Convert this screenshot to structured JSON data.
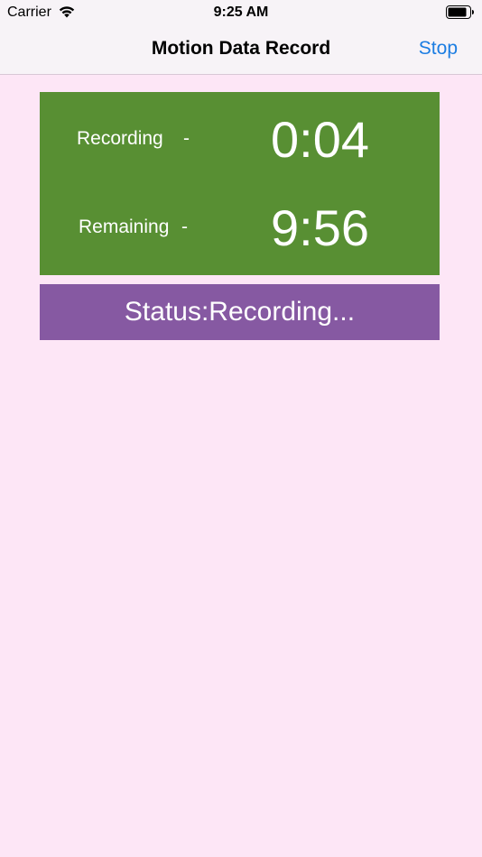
{
  "status_bar": {
    "carrier": "Carrier",
    "time": "9:25 AM"
  },
  "nav": {
    "title": "Motion Data Record",
    "action": "Stop"
  },
  "timers": {
    "recording_label": "Recording",
    "recording_dash": "-",
    "recording_value": "0:04",
    "remaining_label": "Remaining",
    "remaining_dash": "-",
    "remaining_value": "9:56"
  },
  "status": {
    "text": "Status:Recording..."
  },
  "icons": {
    "wifi": "wifi-icon",
    "battery": "battery-icon"
  },
  "colors": {
    "background": "#fde6f6",
    "timer_panel": "#588f33",
    "status_banner": "#8659a2",
    "accent": "#1c7de2"
  }
}
